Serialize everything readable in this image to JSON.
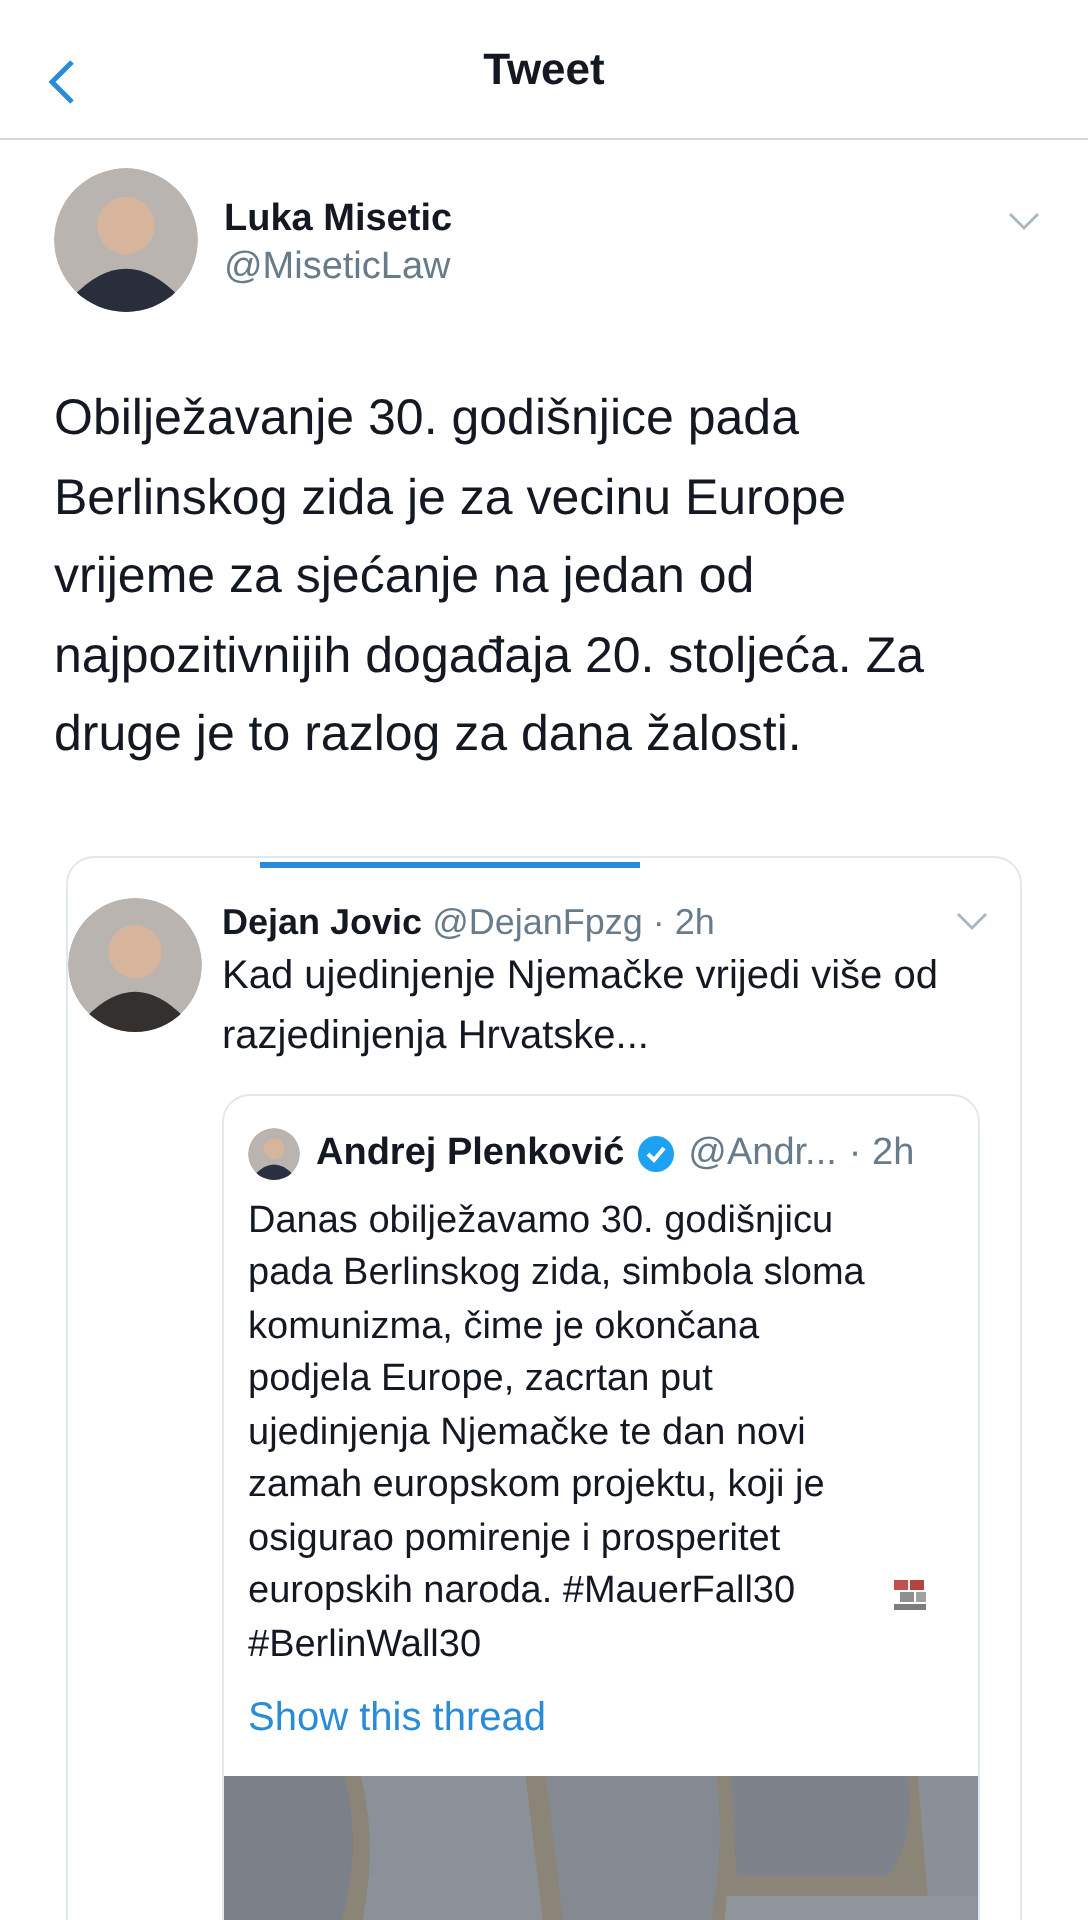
{
  "header": {
    "title": "Tweet"
  },
  "tweet": {
    "name": "Luka Misetic",
    "handle": "@MiseticLaw",
    "text": "Obilježavanje 30. godišnjice pada Berlinskog zida je za vecinu Europe vrijeme za sjećanje na jedan od najpozitivnijih događaja 20. stoljeća. Za druge je to razlog za dana žalosti."
  },
  "quoted": {
    "name": "Dejan Jovic",
    "handle": "@DejanFpzg",
    "time": "· 2h",
    "text": "Kad ujedinjenje Njemačke vrijedi više od razjedinjenja Hrvatske...",
    "quoted": {
      "name": "Andrej Plenković",
      "verified": true,
      "handle": "@Andr...",
      "time": "· 2h",
      "text": "Danas obilježavamo 30. godišnjicu pada Berlinskog zida, simbola sloma komunizma, čime je okončana podjela Europe, zacrtan put ujedinjenja Njemačke te dan novi zamah europskom projektu, koji je osigurao pomirenje i prosperitet europskih naroda. #MauerFall30",
      "hashtag2": "#BerlinWall30",
      "link": "Show this thread"
    }
  }
}
